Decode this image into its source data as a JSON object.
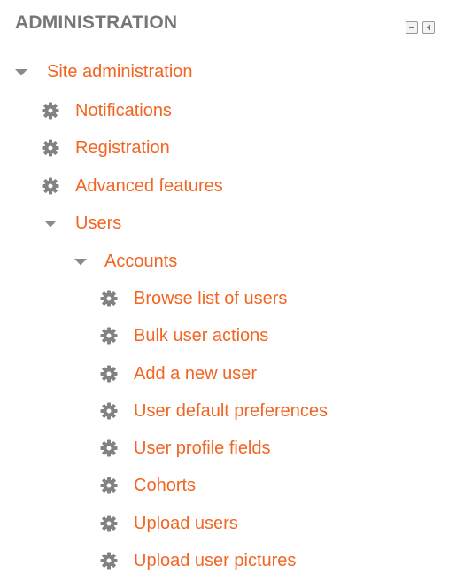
{
  "block": {
    "title": "ADMINISTRATION",
    "controls": {
      "hide_icon": "minus-box-icon",
      "dock_icon": "dock-left-icon"
    }
  },
  "tree": {
    "site_admin": {
      "label": "Site administration",
      "icon": "caret-down-icon",
      "expanded": true
    },
    "notifications": {
      "label": "Notifications",
      "icon": "gear-icon"
    },
    "registration": {
      "label": "Registration",
      "icon": "gear-icon"
    },
    "advanced_features": {
      "label": "Advanced features",
      "icon": "gear-icon"
    },
    "users": {
      "label": "Users",
      "icon": "caret-down-icon",
      "expanded": true
    },
    "accounts": {
      "label": "Accounts",
      "icon": "caret-down-icon",
      "expanded": true
    },
    "account_items": [
      {
        "label": "Browse list of users",
        "icon": "gear-icon"
      },
      {
        "label": "Bulk user actions",
        "icon": "gear-icon"
      },
      {
        "label": "Add a new user",
        "icon": "gear-icon"
      },
      {
        "label": "User default preferences",
        "icon": "gear-icon"
      },
      {
        "label": "User profile fields",
        "icon": "gear-icon"
      },
      {
        "label": "Cohorts",
        "icon": "gear-icon"
      },
      {
        "label": "Upload users",
        "icon": "gear-icon"
      },
      {
        "label": "Upload user pictures",
        "icon": "gear-icon"
      }
    ]
  },
  "colors": {
    "link": "#f26522",
    "title": "#777777",
    "icon": "#7f7f7f"
  }
}
